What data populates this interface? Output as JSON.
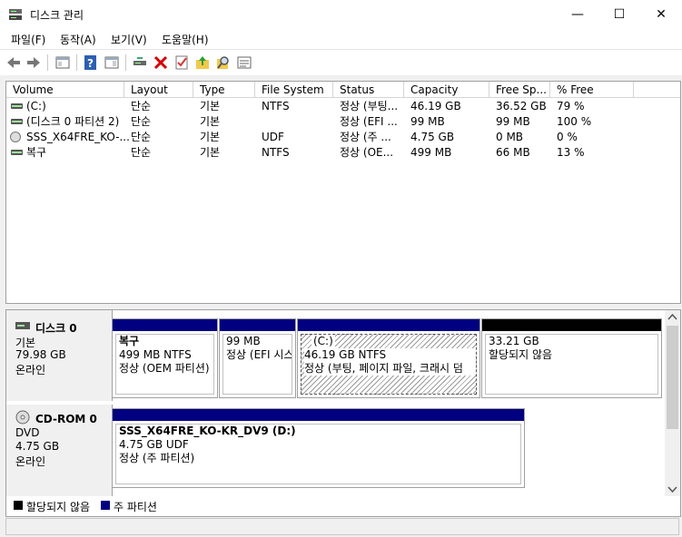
{
  "window": {
    "title": "디스크 관리"
  },
  "menu": [
    "파일(F)",
    "동작(A)",
    "보기(V)",
    "도움말(H)"
  ],
  "list": {
    "columns": [
      "Volume",
      "Layout",
      "Type",
      "File System",
      "Status",
      "Capacity",
      "Free Sp...",
      "% Free"
    ],
    "rows": [
      {
        "icon": "volume-icon",
        "cells": [
          "(C:)",
          "단순",
          "기본",
          "NTFS",
          "정상 (부팅...",
          "46.19 GB",
          "36.52 GB",
          "79 %"
        ]
      },
      {
        "icon": "volume-icon",
        "cells": [
          "(디스크 0 파티션 2)",
          "단순",
          "기본",
          "",
          "정상 (EFI ...",
          "99 MB",
          "99 MB",
          "100 %"
        ]
      },
      {
        "icon": "cd-icon",
        "cells": [
          "SSS_X64FRE_KO-...",
          "단순",
          "기본",
          "UDF",
          "정상 (주 ...",
          "4.75 GB",
          "0 MB",
          "0 %"
        ]
      },
      {
        "icon": "volume-icon",
        "cells": [
          "복구",
          "단순",
          "기본",
          "NTFS",
          "정상 (OE...",
          "499 MB",
          "66 MB",
          "13 %"
        ]
      }
    ]
  },
  "disks": [
    {
      "name": "디스크 0",
      "lines": [
        "기본",
        "79.98 GB",
        "온라인"
      ],
      "partitions": [
        {
          "lines": [
            "복구",
            "499 MB NTFS",
            "정상 (OEM 파티션)"
          ]
        },
        {
          "lines": [
            "",
            "99 MB",
            "정상 (EFI 시스"
          ]
        },
        {
          "lines": [
            "(C:)",
            "46.19 GB NTFS",
            "정상 (부팅, 페이지 파일, 크래시 덤"
          ]
        },
        {
          "lines": [
            "",
            "33.21 GB",
            "할당되지 않음"
          ]
        }
      ]
    },
    {
      "name": "CD-ROM 0",
      "lines": [
        "DVD",
        "4.75 GB",
        "온라인"
      ],
      "partitions": [
        {
          "lines": [
            "SSS_X64FRE_KO-KR_DV9  (D:)",
            "4.75 GB UDF",
            "정상 (주 파티션)"
          ]
        }
      ]
    }
  ],
  "legend": {
    "unallocated": "할당되지 않음",
    "primary": "주 파티션",
    "colors": {
      "unallocated": "#000000",
      "primary": "#000080"
    }
  }
}
